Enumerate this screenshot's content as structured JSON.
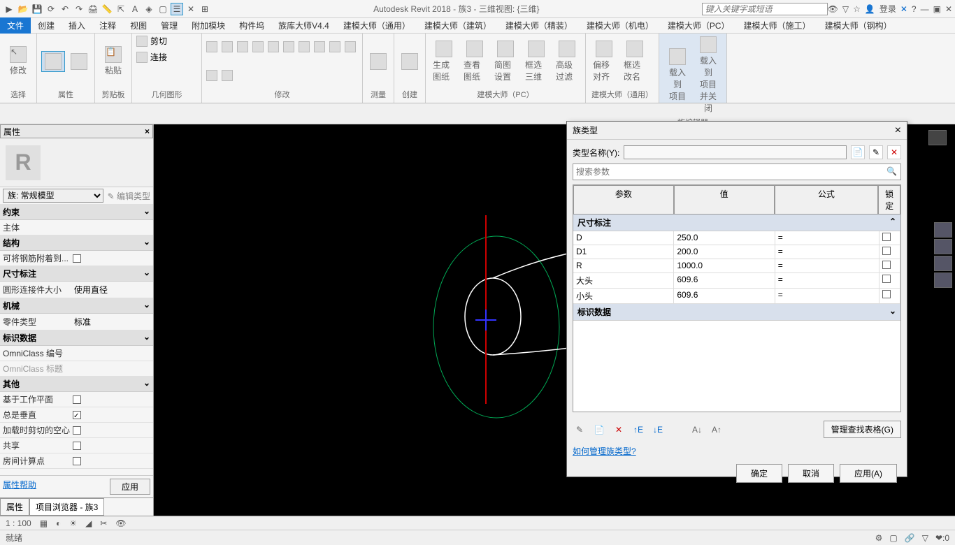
{
  "title": {
    "app": "Autodesk Revit 2018 -",
    "doc": "族3 - 三维视图: {三维}"
  },
  "search_placeholder": "键入关键字或短语",
  "login": "登录",
  "menus": [
    "文件",
    "创建",
    "插入",
    "注释",
    "视图",
    "管理",
    "附加模块",
    "构件坞",
    "族库大师V4.4",
    "建模大师（通用）",
    "建模大师（建筑）",
    "建模大师（精装）",
    "建模大师（机电）",
    "建模大师（PC）",
    "建模大师（施工）",
    "建模大师（钢构）"
  ],
  "ribbon": {
    "select": "选择",
    "select_btn": "修改",
    "props": "属性",
    "clipboard": "剪贴板",
    "paste": "粘贴",
    "geom": "几何图形",
    "cut": "剪切",
    "join": "连接",
    "modify": "修改",
    "measure": "测量",
    "create": "创建",
    "pc": "建模大师（PC）",
    "pc1": "生成图纸",
    "pc2": "查看图纸",
    "pc3": "简图设置",
    "pc4": "框选三维",
    "pc5": "高级过滤",
    "common": "建模大师（通用）",
    "cm1": "偏移对齐",
    "cm2": "框选改名",
    "family": "族编辑器",
    "fm1": "载入到\n项目",
    "fm2": "载入到\n项目并关闭"
  },
  "props": {
    "title": "属性",
    "type": "族: 常规模型",
    "edit_type": "编辑类型",
    "sections": {
      "constraint": "约束",
      "host": "主体",
      "struct": "结构",
      "rebar": "可将钢筋附着到...",
      "dim": "尺寸标注",
      "conn": "圆形连接件大小",
      "conn_val": "使用直径",
      "mech": "机械",
      "part": "零件类型",
      "part_val": "标准",
      "id": "标识数据",
      "omni_no": "OmniClass 编号",
      "omni_title": "OmniClass 标题",
      "other": "其他",
      "workplane": "基于工作平面",
      "vertical": "总是垂直",
      "void_cut": "加载时剪切的空心",
      "shared": "共享",
      "room": "房间计算点"
    },
    "help": "属性帮助",
    "apply": "应用",
    "tabs": [
      "属性",
      "项目浏览器 - 族3"
    ]
  },
  "dialog": {
    "title": "族类型",
    "type_label": "类型名称(Y):",
    "search_ph": "搜索参数",
    "headers": {
      "param": "参数",
      "value": "值",
      "formula": "公式",
      "lock": "锁定"
    },
    "sec_dim": "尺寸标注",
    "rows": [
      {
        "p": "D",
        "v": "250.0",
        "f": "="
      },
      {
        "p": "D1",
        "v": "200.0",
        "f": "="
      },
      {
        "p": "R",
        "v": "1000.0",
        "f": "="
      },
      {
        "p": "大头",
        "v": "609.6",
        "f": "="
      },
      {
        "p": "小头",
        "v": "609.6",
        "f": "="
      }
    ],
    "sec_id": "标识数据",
    "lookup": "管理查找表格(G)",
    "help": "如何管理族类型?",
    "ok": "确定",
    "cancel": "取消",
    "apply": "应用(A)"
  },
  "viewbar": {
    "scale": "1 : 100"
  },
  "status": "就绪",
  "status_right": "❤:0"
}
